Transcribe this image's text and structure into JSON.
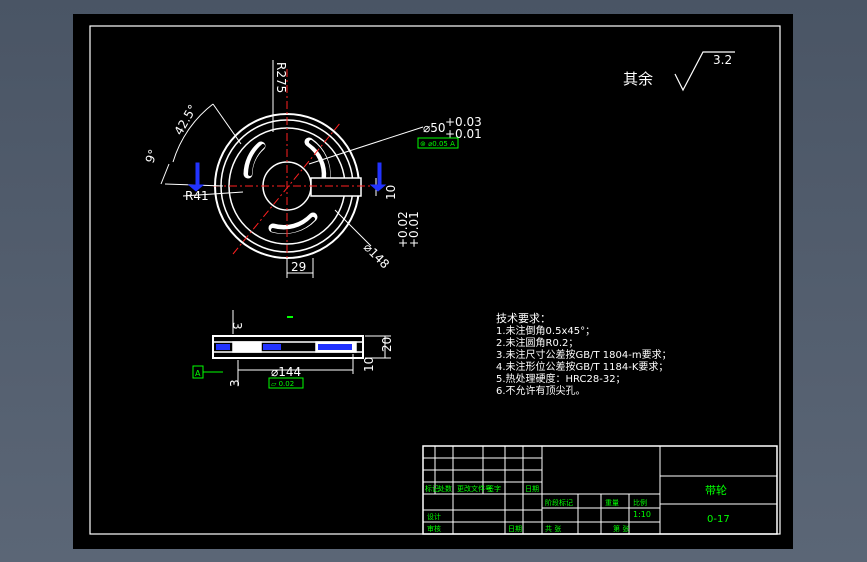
{
  "colors": {
    "background": "#4a5565",
    "sheet": "#000000",
    "line": "#ffffff",
    "center_line": "#ff2020",
    "annotation": "#00ff00",
    "marker": "#2233ff"
  },
  "surface_finish": {
    "label": "其余",
    "value": "3.2"
  },
  "dimensions": {
    "r275": "R275",
    "angle_42_5": "42.5°",
    "angle_9": "9°",
    "r41": "R41",
    "dia50": "⌀50",
    "dia50_tol_upper": "+0.03",
    "dia50_tol_lower": "+0.01",
    "tol_frame": "⊚ ⌀0.05 A",
    "dia148": "⌀148",
    "width29": "29",
    "key_depth": "10",
    "key_tol_upper": "+0.02",
    "key_tol_lower": "+0.01",
    "dia144": "⌀144",
    "dim3_top": "3",
    "dim3_bottom": "3",
    "dim20": "20",
    "dim10": "10",
    "datum": "A",
    "flatness_frame": "⏥ 0.02"
  },
  "tech_requirements": {
    "title": "技术要求：",
    "lines": [
      "1.未注倒角0.5x45°；",
      "2.未注圆角R0.2；",
      "3.未注尺寸公差按GB/T 1804-m要求；",
      "4.未注形位公差按GB/T 1184-K要求；",
      "5.热处理硬度：HRC28-32；",
      "6.不允许有顶尖孔。"
    ]
  },
  "title_block": {
    "part_name": "带轮",
    "drawing_no": "0-17",
    "scale": "1:10",
    "cells": [
      "标记",
      "处数",
      "更改文件号",
      "签字",
      "日期",
      "设计",
      "审核",
      "日期",
      "阶段标记",
      "重量",
      "比例",
      "共 张",
      "第 张"
    ]
  }
}
